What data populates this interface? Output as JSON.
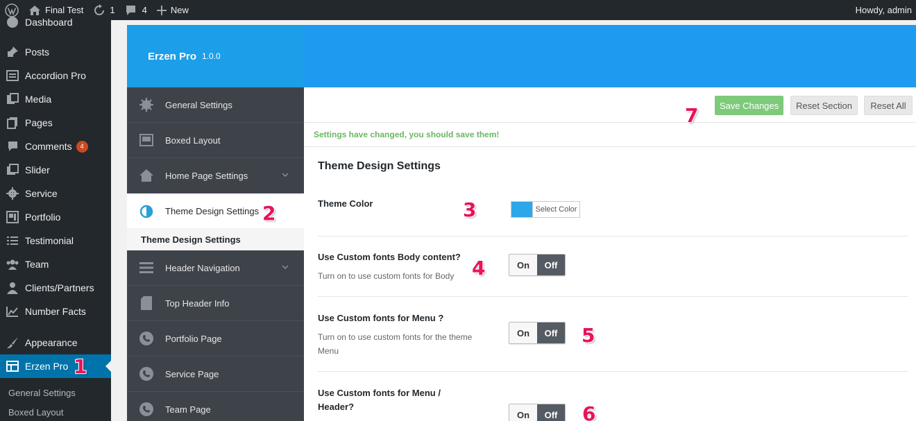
{
  "adminbar": {
    "site_name": "Final Test",
    "updates_count": "1",
    "comments_count": "4",
    "new_label": "New",
    "greeting": "Howdy, admin"
  },
  "wp_menu": {
    "items": [
      {
        "label": "Dashboard",
        "icon": "dashboard-icon"
      },
      {
        "label": "Posts",
        "icon": "pin-icon"
      },
      {
        "label": "Accordion Pro",
        "icon": "list-icon"
      },
      {
        "label": "Media",
        "icon": "media-icon"
      },
      {
        "label": "Pages",
        "icon": "pages-icon"
      },
      {
        "label": "Comments",
        "icon": "comment-icon",
        "badge": "4"
      },
      {
        "label": "Slider",
        "icon": "images-icon"
      },
      {
        "label": "Service",
        "icon": "gear-icon"
      },
      {
        "label": "Portfolio",
        "icon": "portfolio-icon"
      },
      {
        "label": "Testimonial",
        "icon": "list-icon"
      },
      {
        "label": "Team",
        "icon": "groups-icon"
      },
      {
        "label": "Clients/Partners",
        "icon": "user-icon"
      },
      {
        "label": "Number Facts",
        "icon": "chart-icon"
      },
      {
        "label": "Appearance",
        "icon": "brush-icon"
      },
      {
        "label": "Erzen Pro",
        "icon": "table-icon"
      }
    ],
    "submenu": [
      "General Settings",
      "Boxed Layout"
    ]
  },
  "annotations": [
    "1",
    "2",
    "3",
    "4",
    "5",
    "6",
    "7"
  ],
  "panel": {
    "brand_title": "Erzen Pro",
    "brand_version": "1.0.0",
    "nav": [
      {
        "label": "General Settings",
        "icon": "gear-icon"
      },
      {
        "label": "Boxed Layout",
        "icon": "layout-icon"
      },
      {
        "label": "Home Page Settings",
        "icon": "home-icon"
      },
      {
        "label": "Theme Design Settings",
        "icon": "contrast-icon"
      },
      {
        "label": "Header Navigation",
        "icon": "menu-icon"
      },
      {
        "label": "Top Header Info",
        "icon": "document-icon"
      },
      {
        "label": "Portfolio Page",
        "icon": "phone-icon"
      },
      {
        "label": "Service Page",
        "icon": "phone-icon"
      },
      {
        "label": "Team Page",
        "icon": "phone-icon"
      }
    ],
    "nav_sub": "Theme Design Settings",
    "buttons": {
      "save": "Save Changes",
      "reset_section": "Reset Section",
      "reset_all": "Reset All"
    },
    "notice": "Settings have changed, you should save them!",
    "section_title": "Theme Design Settings",
    "fields": {
      "theme_color": {
        "label": "Theme Color",
        "button": "Select Color",
        "color": "#2ea7e8"
      },
      "body_fonts": {
        "label": "Use Custom fonts Body content?",
        "desc": "Turn on to use custom fonts for Body"
      },
      "menu_fonts": {
        "label": "Use Custom fonts for Menu ?",
        "desc": "Turn on to use custom fonts for the theme Menu"
      },
      "header_fonts": {
        "label": "Use Custom fonts for Menu / Header?"
      }
    },
    "switch": {
      "on": "On",
      "off": "Off"
    }
  },
  "colors": {
    "accent": "#1e9bf0",
    "wp_active": "#0073aa",
    "annotation": "#e8135a",
    "save": "#7ec97a"
  }
}
